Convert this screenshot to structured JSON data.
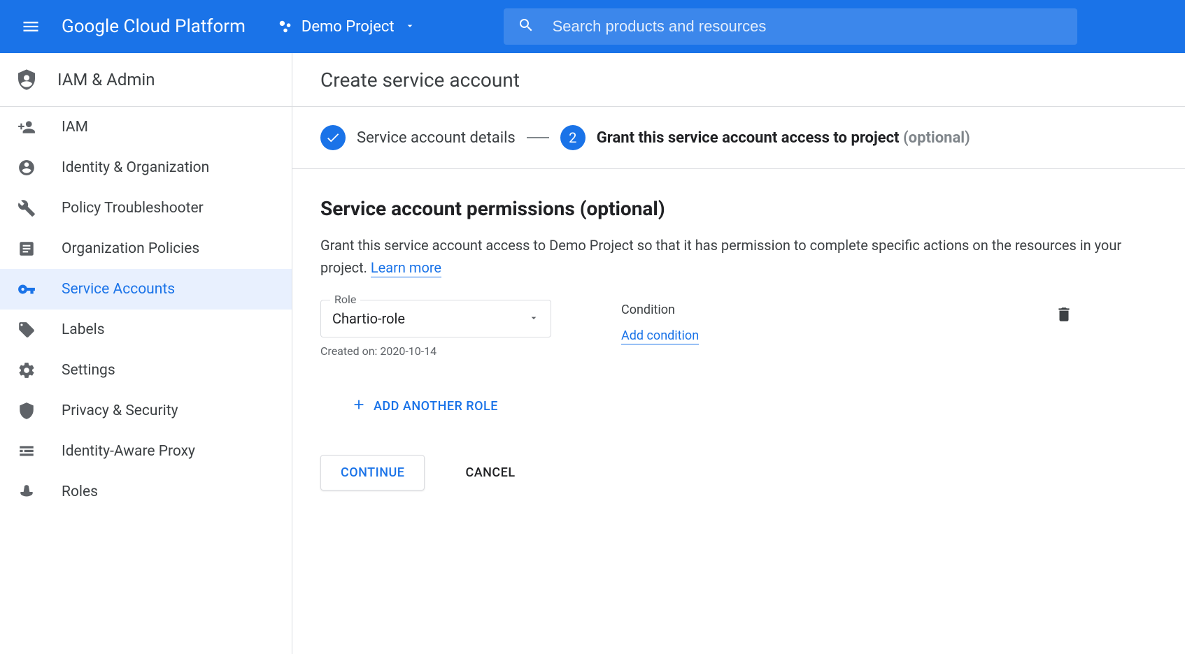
{
  "header": {
    "brand": "Google Cloud Platform",
    "project": "Demo Project",
    "search_placeholder": "Search products and resources"
  },
  "sidebar": {
    "title": "IAM & Admin",
    "items": [
      {
        "label": "IAM",
        "icon": "person-add"
      },
      {
        "label": "Identity & Organization",
        "icon": "account-circle"
      },
      {
        "label": "Policy Troubleshooter",
        "icon": "wrench"
      },
      {
        "label": "Organization Policies",
        "icon": "article"
      },
      {
        "label": "Service Accounts",
        "icon": "key",
        "active": true
      },
      {
        "label": "Labels",
        "icon": "tag"
      },
      {
        "label": "Settings",
        "icon": "gear"
      },
      {
        "label": "Privacy & Security",
        "icon": "shield"
      },
      {
        "label": "Identity-Aware Proxy",
        "icon": "iap"
      },
      {
        "label": "Roles",
        "icon": "hat"
      }
    ]
  },
  "main": {
    "title": "Create service account",
    "stepper": {
      "step1_label": "Service account details",
      "step2_number": "2",
      "step2_label": "Grant this service account access to project",
      "step2_optional": "(optional)"
    },
    "section": {
      "title": "Service account permissions (optional)",
      "desc_prefix": "Grant this service account access to Demo Project so that it has permission to complete specific actions on the resources in your project. ",
      "learn_more": "Learn more"
    },
    "role": {
      "field_label": "Role",
      "value": "Chartio-role",
      "hint": "Created on: 2020-10-14"
    },
    "condition": {
      "label": "Condition",
      "add_link": "Add condition"
    },
    "add_another": "ADD ANOTHER ROLE",
    "actions": {
      "continue": "CONTINUE",
      "cancel": "CANCEL"
    }
  }
}
